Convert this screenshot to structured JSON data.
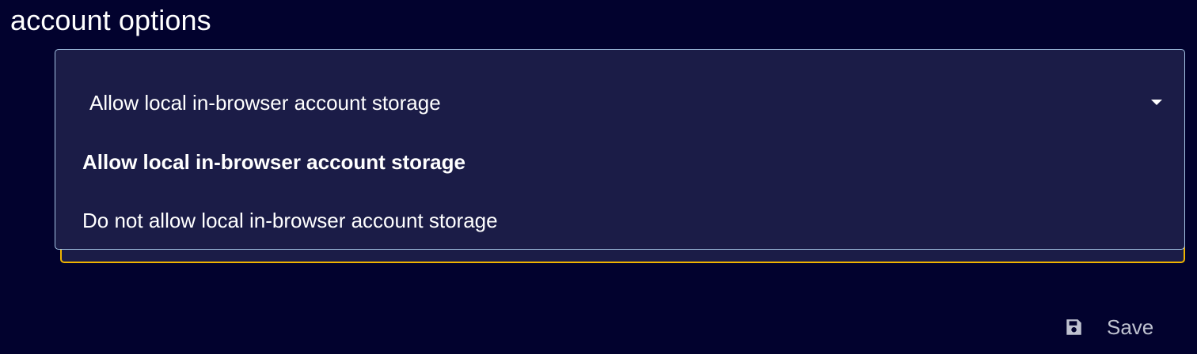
{
  "section": {
    "title": "account options"
  },
  "dropdown": {
    "selected_label": "Allow local in-browser account storage",
    "options": [
      {
        "label": "Allow local in-browser account storage",
        "selected": true
      },
      {
        "label": "Do not allow local in-browser account storage",
        "selected": false
      }
    ]
  },
  "actions": {
    "save_label": "Save",
    "save_icon": "save-icon"
  },
  "colors": {
    "background": "#02022e",
    "panel": "#1b1c47",
    "dropdown_border": "#a5c4e5",
    "focus_border": "#f0b400",
    "text": "#ffffff",
    "muted_text": "#bfc2d0"
  }
}
